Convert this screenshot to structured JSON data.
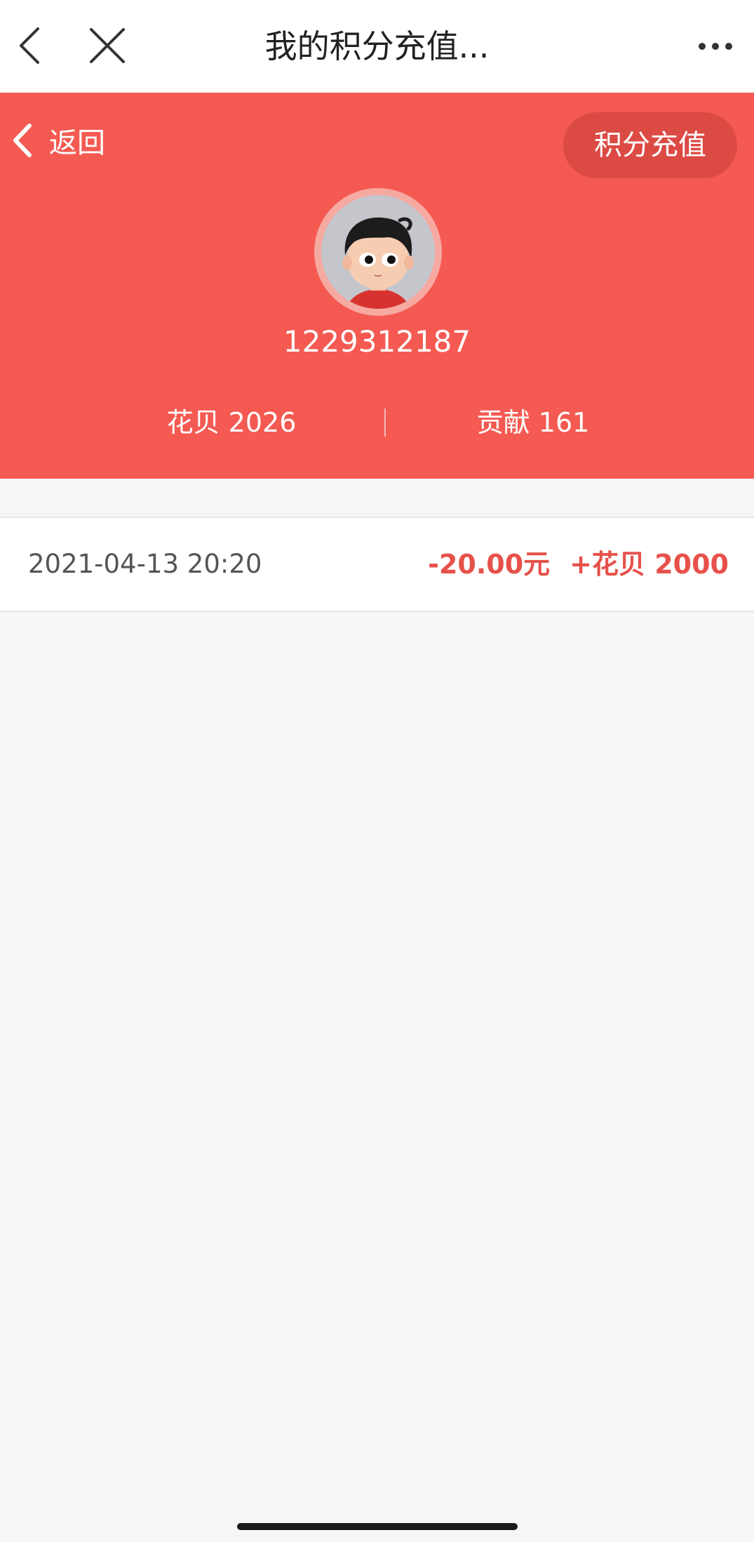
{
  "nav": {
    "title": "我的积分充值...",
    "back_icon": "chevron-left-icon",
    "close_icon": "close-icon",
    "more_icon": "more-horizontal-icon"
  },
  "header": {
    "return_label": "返回",
    "recharge_label": "积分充值",
    "username": "1229312187",
    "stats": {
      "left": "花贝 2026",
      "right": "贡献 161"
    },
    "background_color": "#f45a52"
  },
  "records": [
    {
      "time": "2021-04-13 20:20",
      "amount": "-20.00元",
      "points": "+花贝 2000"
    }
  ],
  "colors": {
    "accent": "#f45a52",
    "amount_text": "#e6514a"
  }
}
